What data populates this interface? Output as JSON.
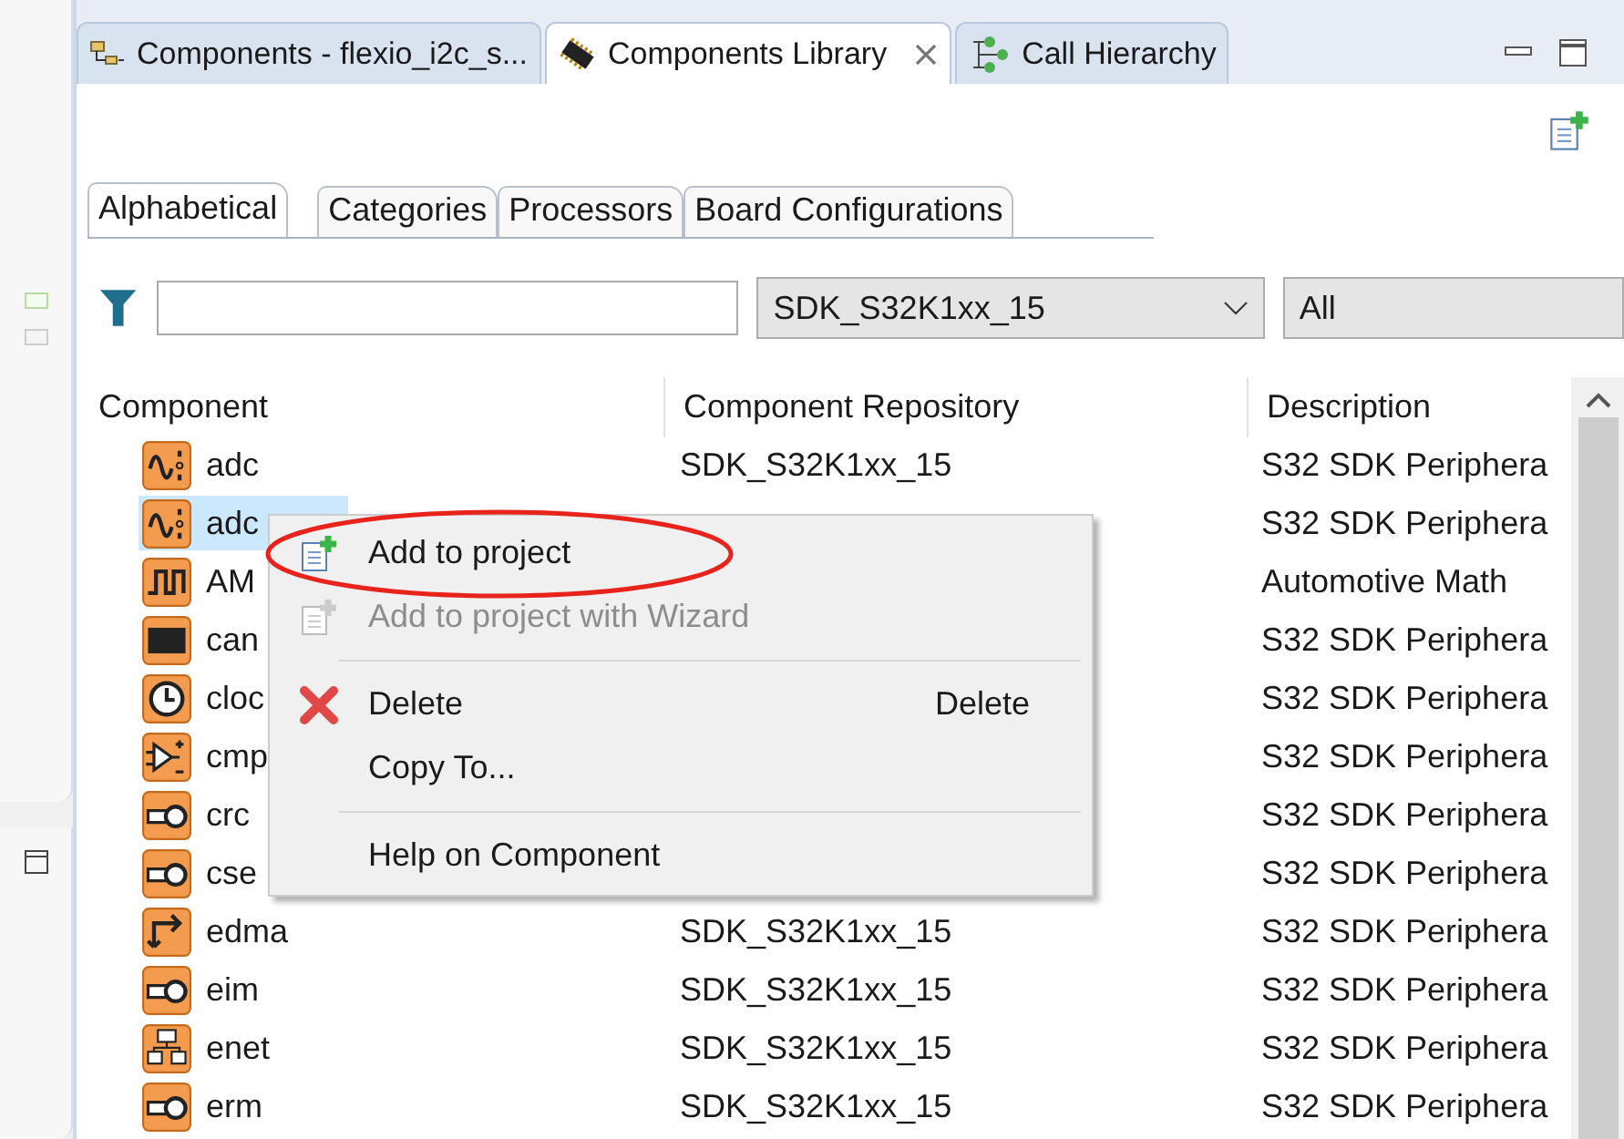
{
  "view_tabs": [
    {
      "label": "Components - flexio_i2c_s...",
      "selected": false,
      "kind": "tree"
    },
    {
      "label": "Components Library",
      "selected": true,
      "kind": "chip"
    },
    {
      "label": "Call Hierarchy",
      "selected": false,
      "kind": "hierarchy"
    }
  ],
  "sub_tabs": [
    {
      "label": "Alphabetical",
      "selected": true
    },
    {
      "label": "Categories",
      "selected": false
    },
    {
      "label": "Processors",
      "selected": false
    },
    {
      "label": "Board Configurations",
      "selected": false
    }
  ],
  "filter": {
    "repository": "SDK_S32K1xx_15",
    "scope": "All"
  },
  "table": {
    "columns": [
      "Component",
      "Component Repository",
      "Description"
    ],
    "rows": [
      {
        "name": "adc",
        "kind": "wave",
        "repository": "SDK_S32K1xx_15",
        "description": "S32 SDK Periphera",
        "selected": false
      },
      {
        "name": "adc",
        "kind": "wave",
        "description": "S32 SDK Periphera",
        "selected": true
      },
      {
        "name": "AM",
        "kind": "pulse",
        "description": "Automotive Math",
        "selected": false
      },
      {
        "name": "can",
        "kind": "can",
        "description": "S32 SDK Periphera",
        "selected": false
      },
      {
        "name": "cloc",
        "kind": "clock",
        "description": "S32 SDK Periphera",
        "selected": false
      },
      {
        "name": "cmp",
        "kind": "comparator",
        "description": "S32 SDK Periphera",
        "selected": false
      },
      {
        "name": "crc",
        "kind": "key",
        "description": "S32 SDK Periphera",
        "selected": false
      },
      {
        "name": "cse",
        "kind": "key",
        "description": "S32 SDK Periphera",
        "selected": false
      },
      {
        "name": "edma",
        "kind": "arrows",
        "repository": "SDK_S32K1xx_15",
        "description": "S32 SDK Periphera",
        "selected": false
      },
      {
        "name": "eim",
        "kind": "key",
        "repository": "SDK_S32K1xx_15",
        "description": "S32 SDK Periphera",
        "selected": false
      },
      {
        "name": "enet",
        "kind": "network",
        "repository": "SDK_S32K1xx_15",
        "description": "S32 SDK Periphera",
        "selected": false
      },
      {
        "name": "erm",
        "kind": "key",
        "repository": "SDK_S32K1xx_15",
        "description": "S32 SDK Periphera",
        "selected": false
      }
    ]
  },
  "context_menu": {
    "items": [
      {
        "kind": "add",
        "label": "Add to project",
        "disabled": false,
        "circled": true
      },
      {
        "kind": "add",
        "label": "Add to project with Wizard",
        "disabled": true,
        "circled": false
      },
      {
        "kind": "separator"
      },
      {
        "kind": "delete",
        "label": "Delete",
        "shortcut": "Delete",
        "disabled": false,
        "circled": false
      },
      {
        "kind": "text",
        "label": "Copy To...",
        "disabled": false,
        "circled": false
      },
      {
        "kind": "separator"
      },
      {
        "kind": "text",
        "label": "Help on Component",
        "disabled": false,
        "circled": false
      }
    ]
  }
}
